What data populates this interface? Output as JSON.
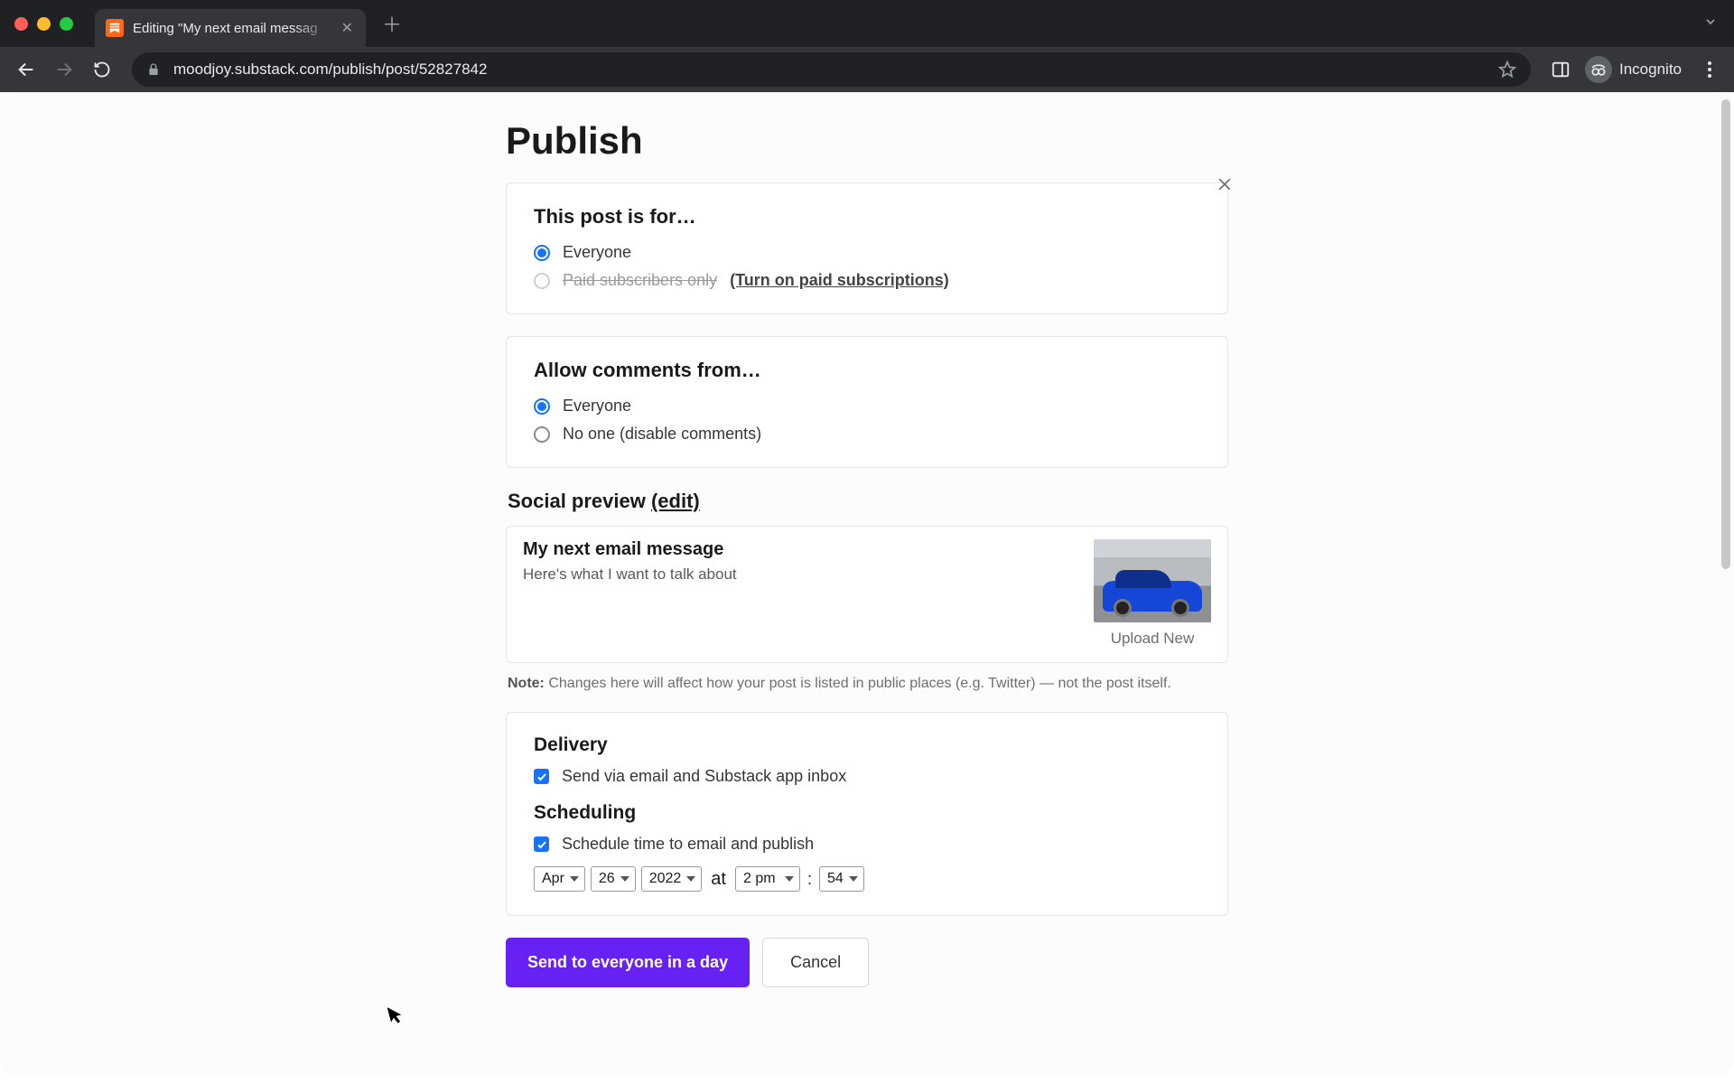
{
  "browser": {
    "tab_title": "Editing \"My next email messag",
    "url": "moodjoy.substack.com/publish/post/52827842",
    "incognito_label": "Incognito"
  },
  "page": {
    "title": "Publish"
  },
  "audience": {
    "heading": "This post is for…",
    "options": {
      "everyone": "Everyone",
      "paid": "Paid subscribers only",
      "paid_cta": "(Turn on paid subscriptions)"
    }
  },
  "comments": {
    "heading": "Allow comments from…",
    "options": {
      "everyone": "Everyone",
      "none": "No one (disable comments)"
    }
  },
  "social": {
    "heading_prefix": "Social preview ",
    "edit_label": "(edit)",
    "preview_title": "My next email message",
    "preview_desc": "Here's what I want to talk about",
    "upload_label": "Upload New",
    "note_label": "Note:",
    "note_text": " Changes here will affect how your post is listed in public places (e.g. Twitter) — not the post itself."
  },
  "delivery": {
    "heading": "Delivery",
    "send_label": "Send via email and Substack app inbox"
  },
  "scheduling": {
    "heading": "Scheduling",
    "schedule_label": "Schedule time to email and publish",
    "month": "Apr",
    "day": "26",
    "year": "2022",
    "at_word": "at",
    "hour": "2 pm",
    "minute": "54"
  },
  "buttons": {
    "primary": "Send to everyone in a day",
    "cancel": "Cancel"
  }
}
